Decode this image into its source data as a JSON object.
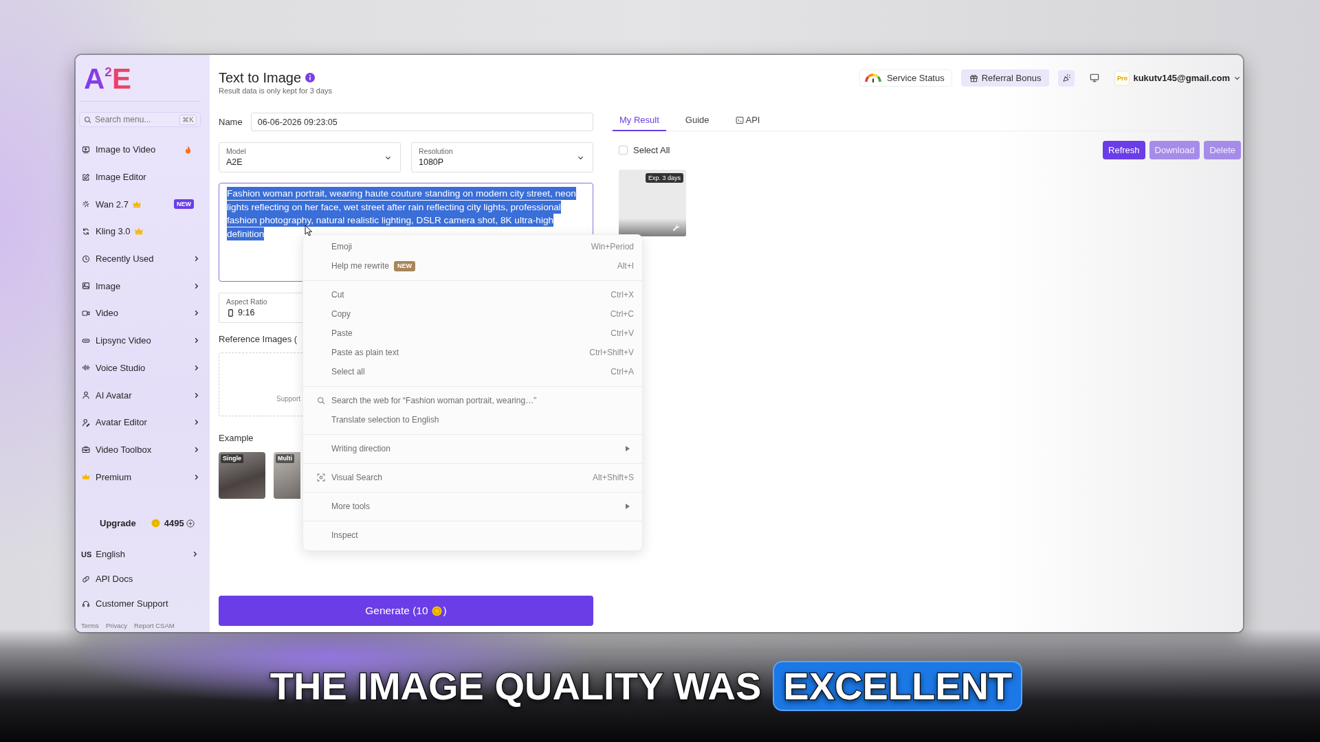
{
  "sidebar": {
    "logo": "A$^{2}$E",
    "search": {
      "placeholder": "Search menu...",
      "shortcut": "⌘K"
    },
    "items": [
      {
        "label": "Image to Video",
        "trending": true,
        "premium": false,
        "submenu": false
      },
      {
        "label": "Image Editor",
        "trending": false,
        "premium": false,
        "submenu": false
      },
      {
        "label": "Wan 2.7",
        "trending": false,
        "premium": true,
        "badge": "NEW",
        "submenu": false
      },
      {
        "label": "Kling 3.0",
        "trending": false,
        "premium": true,
        "submenu": false
      },
      {
        "label": "Recently Used",
        "trending": false,
        "premium": false,
        "submenu": true
      },
      {
        "label": "Image",
        "trending": false,
        "premium": false,
        "submenu": true
      },
      {
        "label": "Video",
        "trending": false,
        "premium": false,
        "submenu": true
      },
      {
        "label": "Lipsync Video",
        "trending": false,
        "premium": false,
        "submenu": true
      },
      {
        "label": "Voice Studio",
        "trending": false,
        "premium": false,
        "submenu": true
      },
      {
        "label": "AI Avatar",
        "trending": false,
        "premium": false,
        "submenu": true
      },
      {
        "label": "Avatar Editor",
        "trending": false,
        "premium": false,
        "submenu": true
      },
      {
        "label": "Video Toolbox",
        "trending": false,
        "premium": false,
        "submenu": true
      },
      {
        "label": "Premium",
        "trending": false,
        "premium": false,
        "submenu": true
      }
    ],
    "upgrade": {
      "label": "Upgrade",
      "credits": "4495"
    },
    "language": {
      "code": "US",
      "label": "English"
    },
    "links": [
      {
        "label": "API Docs"
      },
      {
        "label": "Customer Support"
      }
    ],
    "footer": [
      "Terms",
      "Privacy",
      "Report CSAM"
    ]
  },
  "header": {
    "title": "Text to Image",
    "subtitle": "Result data is only kept for 3 days",
    "service_status": "Service Status",
    "referral": "Referral Bonus",
    "plan": "Pro",
    "email": "kukutv145@gmail.com"
  },
  "form": {
    "name": {
      "label": "Name",
      "value": "06-06-2026 09:23:05"
    },
    "selects": [
      {
        "label": "Model",
        "value": "A2E"
      },
      {
        "label": "Resolution",
        "value": "1080P"
      }
    ],
    "prompt": {
      "value": "Fashion woman portrait, wearing haute couture standing on modern city street, neon lights reflecting on her face, wet street after rain reflecting city lights, professional fashion photography, natural realistic lighting, DSLR camera shot, 8K ultra-high definition",
      "focused": true,
      "text_selected": true
    },
    "aspect": {
      "label": "Aspect Ratio",
      "value": "9:16"
    },
    "reference": {
      "label": "Reference Images (",
      "hint": "Support"
    },
    "examples": {
      "label": "Example",
      "items": [
        {
          "badge": "Single"
        },
        {
          "badge": "Multi"
        }
      ]
    },
    "generate": {
      "label": "Generate (10",
      "closing": ")"
    }
  },
  "results": {
    "tabs": [
      {
        "label": "My Result",
        "selected": true,
        "kind": "plain"
      },
      {
        "label": "Guide",
        "selected": false,
        "kind": "plain"
      },
      {
        "label": "API",
        "selected": false,
        "kind": "code"
      }
    ],
    "select_all": {
      "label": "Select All",
      "checked": false
    },
    "buttons": [
      {
        "label": "Refresh",
        "disabled": false
      },
      {
        "label": "Download",
        "disabled": true
      },
      {
        "label": "Delete",
        "disabled": true
      }
    ],
    "items": [
      {
        "expiry": "Exp. 3 days"
      }
    ]
  },
  "context_menu": {
    "groups": [
      {
        "items": [
          {
            "kind": "action",
            "label": "Emoji",
            "shortcut": "Win+Period"
          },
          {
            "kind": "action",
            "label": "Help me rewrite",
            "badge": "NEW",
            "shortcut": "Alt+I"
          }
        ]
      },
      {
        "items": [
          {
            "kind": "action",
            "label": "Cut",
            "shortcut": "Ctrl+X"
          },
          {
            "kind": "action",
            "label": "Copy",
            "shortcut": "Ctrl+C"
          },
          {
            "kind": "action",
            "label": "Paste",
            "shortcut": "Ctrl+V"
          },
          {
            "kind": "action",
            "label": "Paste as plain text",
            "shortcut": "Ctrl+Shift+V"
          },
          {
            "kind": "action",
            "label": "Select all",
            "shortcut": "Ctrl+A"
          }
        ]
      },
      {
        "items": [
          {
            "kind": "search",
            "label": "Search the web for “Fashion woman portrait, wearing…”"
          },
          {
            "kind": "action",
            "label": "Translate selection to English"
          }
        ]
      },
      {
        "items": [
          {
            "kind": "submenu",
            "label": "Writing direction"
          }
        ]
      },
      {
        "items": [
          {
            "kind": "visual",
            "label": "Visual Search",
            "shortcut": "Alt+Shift+S"
          }
        ]
      },
      {
        "items": [
          {
            "kind": "submenu",
            "label": "More tools"
          }
        ]
      },
      {
        "items": [
          {
            "kind": "action",
            "label": "Inspect"
          }
        ]
      }
    ]
  },
  "caption": {
    "text": "THE IMAGE QUALITY WAS",
    "highlight": "EXCELLENT"
  }
}
